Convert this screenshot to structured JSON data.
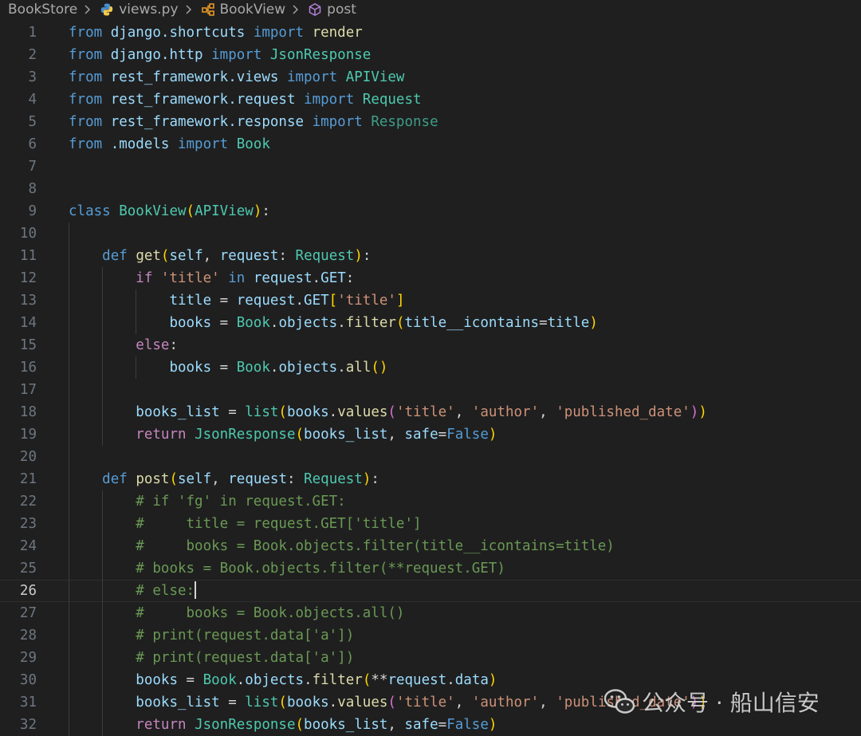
{
  "breadcrumb": {
    "items": [
      {
        "label": "BookStore",
        "icon": ""
      },
      {
        "label": "views.py",
        "icon": "python-file-icon"
      },
      {
        "label": "BookView",
        "icon": "class-symbol-icon"
      },
      {
        "label": "post",
        "icon": "method-symbol-icon"
      }
    ],
    "separator_icon": "chevron-right-icon"
  },
  "editor": {
    "current_line": 26,
    "lines": [
      {
        "n": "1",
        "tokens": [
          [
            "from",
            "kw"
          ],
          [
            " django.shortcuts ",
            "var"
          ],
          [
            "import",
            "kw"
          ],
          [
            " render",
            "fn"
          ]
        ]
      },
      {
        "n": "2",
        "tokens": [
          [
            "from",
            "kw"
          ],
          [
            " django.http ",
            "var"
          ],
          [
            "import",
            "kw"
          ],
          [
            " JsonResponse",
            "cls"
          ]
        ]
      },
      {
        "n": "3",
        "tokens": [
          [
            "from",
            "kw"
          ],
          [
            " rest_framework.views ",
            "var"
          ],
          [
            "import",
            "kw"
          ],
          [
            " APIView",
            "cls"
          ]
        ]
      },
      {
        "n": "4",
        "tokens": [
          [
            "from",
            "kw"
          ],
          [
            " rest_framework.request ",
            "var"
          ],
          [
            "import",
            "kw"
          ],
          [
            " Request",
            "cls"
          ]
        ]
      },
      {
        "n": "5",
        "tokens": [
          [
            "from",
            "kw"
          ],
          [
            " rest_framework.response ",
            "var"
          ],
          [
            "import",
            "kw"
          ],
          [
            " Response",
            "cls2"
          ]
        ]
      },
      {
        "n": "6",
        "tokens": [
          [
            "from",
            "kw"
          ],
          [
            " .models ",
            "var"
          ],
          [
            "import",
            "kw"
          ],
          [
            " Book",
            "cls"
          ]
        ]
      },
      {
        "n": "7",
        "tokens": []
      },
      {
        "n": "8",
        "tokens": []
      },
      {
        "n": "9",
        "tokens": [
          [
            "class",
            "kw"
          ],
          [
            " ",
            "txt"
          ],
          [
            "BookView",
            "cls"
          ],
          [
            "(",
            "br"
          ],
          [
            "APIView",
            "cls"
          ],
          [
            ")",
            "br"
          ],
          [
            ":",
            "txt"
          ]
        ]
      },
      {
        "n": "10",
        "tokens": []
      },
      {
        "n": "11",
        "tokens": [
          [
            "    ",
            "txt"
          ],
          [
            "def",
            "kw"
          ],
          [
            " ",
            "txt"
          ],
          [
            "get",
            "fn"
          ],
          [
            "(",
            "br"
          ],
          [
            "self",
            "self"
          ],
          [
            ", ",
            "txt"
          ],
          [
            "request",
            "var"
          ],
          [
            ": ",
            "txt"
          ],
          [
            "Request",
            "cls"
          ],
          [
            ")",
            "br"
          ],
          [
            ":",
            "txt"
          ]
        ]
      },
      {
        "n": "12",
        "tokens": [
          [
            "        ",
            "txt"
          ],
          [
            "if",
            "ctl"
          ],
          [
            " ",
            "txt"
          ],
          [
            "'title'",
            "str"
          ],
          [
            " ",
            "txt"
          ],
          [
            "in",
            "kw"
          ],
          [
            " ",
            "txt"
          ],
          [
            "request",
            "var"
          ],
          [
            ".",
            "txt"
          ],
          [
            "GET",
            "var"
          ],
          [
            ":",
            "txt"
          ]
        ]
      },
      {
        "n": "13",
        "tokens": [
          [
            "            ",
            "txt"
          ],
          [
            "title",
            "var"
          ],
          [
            " = ",
            "txt"
          ],
          [
            "request",
            "var"
          ],
          [
            ".",
            "txt"
          ],
          [
            "GET",
            "var"
          ],
          [
            "[",
            "br"
          ],
          [
            "'title'",
            "str"
          ],
          [
            "]",
            "br"
          ]
        ]
      },
      {
        "n": "14",
        "tokens": [
          [
            "            ",
            "txt"
          ],
          [
            "books",
            "var"
          ],
          [
            " = ",
            "txt"
          ],
          [
            "Book",
            "cls"
          ],
          [
            ".",
            "txt"
          ],
          [
            "objects",
            "var"
          ],
          [
            ".",
            "txt"
          ],
          [
            "filter",
            "fn"
          ],
          [
            "(",
            "br"
          ],
          [
            "title__icontains",
            "var"
          ],
          [
            "=",
            "txt"
          ],
          [
            "title",
            "var"
          ],
          [
            ")",
            "br"
          ]
        ]
      },
      {
        "n": "15",
        "tokens": [
          [
            "        ",
            "txt"
          ],
          [
            "else",
            "ctl"
          ],
          [
            ":",
            "txt"
          ]
        ]
      },
      {
        "n": "16",
        "tokens": [
          [
            "            ",
            "txt"
          ],
          [
            "books",
            "var"
          ],
          [
            " = ",
            "txt"
          ],
          [
            "Book",
            "cls"
          ],
          [
            ".",
            "txt"
          ],
          [
            "objects",
            "var"
          ],
          [
            ".",
            "txt"
          ],
          [
            "all",
            "fn"
          ],
          [
            "()",
            "br"
          ]
        ]
      },
      {
        "n": "17",
        "tokens": []
      },
      {
        "n": "18",
        "tokens": [
          [
            "        ",
            "txt"
          ],
          [
            "books_list",
            "var"
          ],
          [
            " = ",
            "txt"
          ],
          [
            "list",
            "cls"
          ],
          [
            "(",
            "br"
          ],
          [
            "books",
            "var"
          ],
          [
            ".",
            "txt"
          ],
          [
            "values",
            "fn"
          ],
          [
            "(",
            "br2"
          ],
          [
            "'title'",
            "str"
          ],
          [
            ", ",
            "txt"
          ],
          [
            "'author'",
            "str"
          ],
          [
            ", ",
            "txt"
          ],
          [
            "'published_date'",
            "str"
          ],
          [
            ")",
            "br2"
          ],
          [
            ")",
            "br"
          ]
        ]
      },
      {
        "n": "19",
        "tokens": [
          [
            "        ",
            "txt"
          ],
          [
            "return",
            "ctl"
          ],
          [
            " ",
            "txt"
          ],
          [
            "JsonResponse",
            "cls"
          ],
          [
            "(",
            "br"
          ],
          [
            "books_list",
            "var"
          ],
          [
            ", ",
            "txt"
          ],
          [
            "safe",
            "var"
          ],
          [
            "=",
            "txt"
          ],
          [
            "False",
            "kw"
          ],
          [
            ")",
            "br"
          ]
        ]
      },
      {
        "n": "20",
        "tokens": []
      },
      {
        "n": "21",
        "tokens": [
          [
            "    ",
            "txt"
          ],
          [
            "def",
            "kw"
          ],
          [
            " ",
            "txt"
          ],
          [
            "post",
            "fn"
          ],
          [
            "(",
            "br"
          ],
          [
            "self",
            "self"
          ],
          [
            ", ",
            "txt"
          ],
          [
            "request",
            "var"
          ],
          [
            ": ",
            "txt"
          ],
          [
            "Request",
            "cls"
          ],
          [
            ")",
            "br"
          ],
          [
            ":",
            "txt"
          ]
        ]
      },
      {
        "n": "22",
        "tokens": [
          [
            "        ",
            "txt"
          ],
          [
            "# if 'fg' in request.GET:",
            "cmt"
          ]
        ]
      },
      {
        "n": "23",
        "tokens": [
          [
            "        ",
            "txt"
          ],
          [
            "#     title = request.GET['title']",
            "cmt"
          ]
        ]
      },
      {
        "n": "24",
        "tokens": [
          [
            "        ",
            "txt"
          ],
          [
            "#     books = Book.objects.filter(title__icontains=title)",
            "cmt"
          ]
        ]
      },
      {
        "n": "25",
        "tokens": [
          [
            "        ",
            "txt"
          ],
          [
            "# books = Book.objects.filter(**request.GET)",
            "cmt"
          ]
        ]
      },
      {
        "n": "26",
        "tokens": [
          [
            "        ",
            "txt"
          ],
          [
            "# else:",
            "cmt"
          ]
        ],
        "cursor": true
      },
      {
        "n": "27",
        "tokens": [
          [
            "        ",
            "txt"
          ],
          [
            "#     books = Book.objects.all()",
            "cmt"
          ]
        ]
      },
      {
        "n": "28",
        "tokens": [
          [
            "        ",
            "txt"
          ],
          [
            "# print(request.data['a'])",
            "cmt"
          ]
        ]
      },
      {
        "n": "29",
        "tokens": [
          [
            "        ",
            "txt"
          ],
          [
            "# print(request.data['a'])",
            "cmt"
          ]
        ]
      },
      {
        "n": "30",
        "tokens": [
          [
            "        ",
            "txt"
          ],
          [
            "books",
            "var"
          ],
          [
            " = ",
            "txt"
          ],
          [
            "Book",
            "cls"
          ],
          [
            ".",
            "txt"
          ],
          [
            "objects",
            "var"
          ],
          [
            ".",
            "txt"
          ],
          [
            "filter",
            "fn"
          ],
          [
            "(",
            "br"
          ],
          [
            "**",
            "txt"
          ],
          [
            "request",
            "var"
          ],
          [
            ".",
            "txt"
          ],
          [
            "data",
            "var"
          ],
          [
            ")",
            "br"
          ]
        ]
      },
      {
        "n": "31",
        "tokens": [
          [
            "        ",
            "txt"
          ],
          [
            "books_list",
            "var"
          ],
          [
            " = ",
            "txt"
          ],
          [
            "list",
            "cls"
          ],
          [
            "(",
            "br"
          ],
          [
            "books",
            "var"
          ],
          [
            ".",
            "txt"
          ],
          [
            "values",
            "fn"
          ],
          [
            "(",
            "br2"
          ],
          [
            "'title'",
            "str"
          ],
          [
            ", ",
            "txt"
          ],
          [
            "'author'",
            "str"
          ],
          [
            ", ",
            "txt"
          ],
          [
            "'published_date'",
            "str"
          ],
          [
            ")",
            "br2"
          ],
          [
            ")",
            "br"
          ]
        ]
      },
      {
        "n": "32",
        "tokens": [
          [
            "        ",
            "txt"
          ],
          [
            "return",
            "ctl"
          ],
          [
            " ",
            "txt"
          ],
          [
            "JsonResponse",
            "cls"
          ],
          [
            "(",
            "br"
          ],
          [
            "books_list",
            "var"
          ],
          [
            ", ",
            "txt"
          ],
          [
            "safe",
            "var"
          ],
          [
            "=",
            "txt"
          ],
          [
            "False",
            "kw"
          ],
          [
            ")",
            "br"
          ]
        ]
      }
    ]
  },
  "watermark": {
    "text": "公众号 · 船山信安",
    "icon": "wechat-icon"
  }
}
